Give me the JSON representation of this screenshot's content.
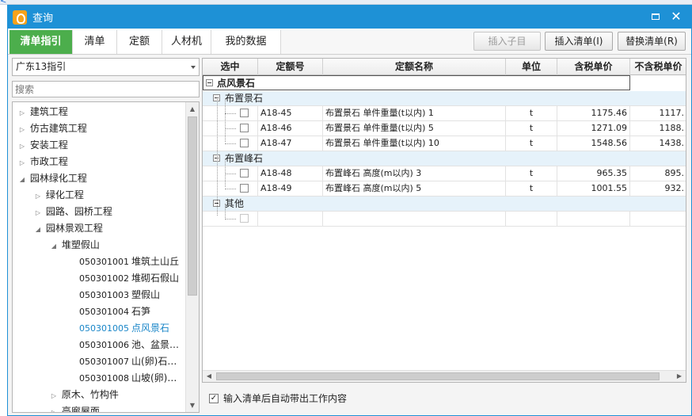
{
  "window": {
    "title": "查询"
  },
  "tabs": [
    "清单指引",
    "清单",
    "定额",
    "人材机",
    "我的数据"
  ],
  "toolbar": {
    "insert_child": "插入子目",
    "insert_list": "插入清单(I)",
    "replace_list": "替换清单(R)"
  },
  "left": {
    "combo_value": "广东13指引",
    "search_placeholder": "搜索",
    "tree": {
      "t0": "建筑工程",
      "t1": "仿古建筑工程",
      "t2": "安装工程",
      "t3": "市政工程",
      "t4": "园林绿化工程",
      "t5": "绿化工程",
      "t6": "园路、园桥工程",
      "t7": "园林景观工程",
      "t8": "堆塑假山",
      "c1": {
        "code": "050301001",
        "name": "堆筑土山丘"
      },
      "c2": {
        "code": "050301002",
        "name": "堆砌石假山"
      },
      "c3": {
        "code": "050301003",
        "name": "塑假山"
      },
      "c4": {
        "code": "050301004",
        "name": "石笋"
      },
      "c5": {
        "code": "050301005",
        "name": "点风景石"
      },
      "c6": {
        "code": "050301006",
        "name": "池、盆景…"
      },
      "c7": {
        "code": "050301007",
        "name": "山(卵)石…"
      },
      "c8": {
        "code": "050301008",
        "name": "山坡(卵)…"
      },
      "t9": "原木、竹构件",
      "t10": "亭廊屋面"
    }
  },
  "grid": {
    "headers": {
      "select": "选中",
      "code": "定额号",
      "name": "定额名称",
      "unit": "单位",
      "price_tax": "含税单价",
      "price_notax": "不含税单价"
    },
    "root": "点风景石",
    "g1": "布置景石",
    "g2": "布置峰石",
    "g3": "其他",
    "r1": {
      "code": "A18-45",
      "name": "布置景石 单件重量(t以内) 1",
      "unit": "t",
      "tax": "1175.46",
      "notax": "1117."
    },
    "r2": {
      "code": "A18-46",
      "name": "布置景石 单件重量(t以内) 5",
      "unit": "t",
      "tax": "1271.09",
      "notax": "1188."
    },
    "r3": {
      "code": "A18-47",
      "name": "布置景石 单件重量(t以内) 10",
      "unit": "t",
      "tax": "1548.56",
      "notax": "1438."
    },
    "r4": {
      "code": "A18-48",
      "name": "布置峰石 高度(m以内) 3",
      "unit": "t",
      "tax": "965.35",
      "notax": "895."
    },
    "r5": {
      "code": "A18-49",
      "name": "布置峰石 高度(m以内) 5",
      "unit": "t",
      "tax": "1001.55",
      "notax": "932."
    }
  },
  "option": {
    "auto_label": "输入清单后自动带出工作内容",
    "checked": true
  }
}
